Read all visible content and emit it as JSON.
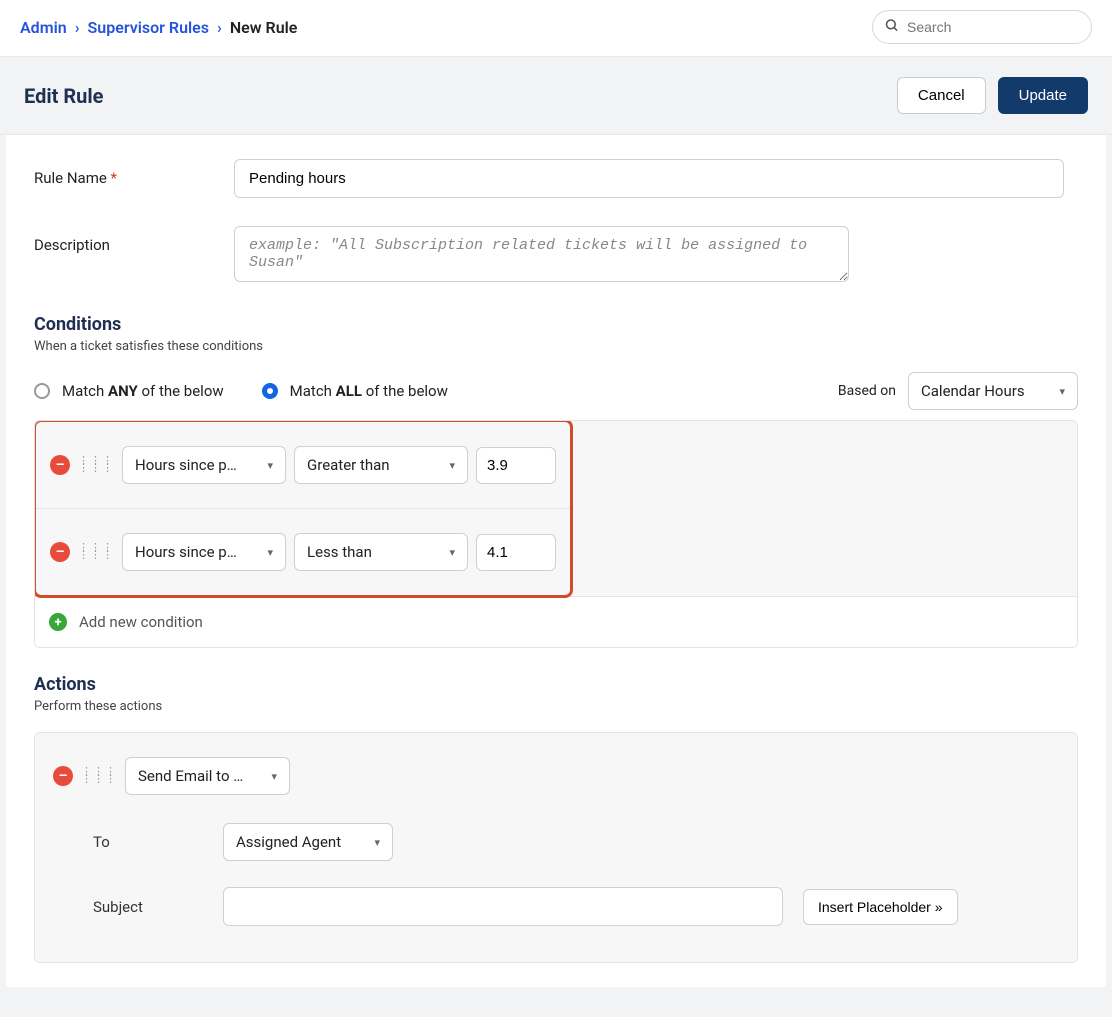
{
  "breadcrumb": {
    "admin": "Admin",
    "rules": "Supervisor Rules",
    "current": "New Rule"
  },
  "search": {
    "placeholder": "Search"
  },
  "header": {
    "title": "Edit Rule",
    "cancel": "Cancel",
    "update": "Update"
  },
  "form": {
    "ruleNameLabel": "Rule Name",
    "ruleNameValue": "Pending hours",
    "descLabel": "Description",
    "descPlaceholder": "example: \"All Subscription related tickets will be assigned to Susan\""
  },
  "conditions": {
    "title": "Conditions",
    "subtitle": "When a ticket satisfies these conditions",
    "matchAnyPrefix": "Match ",
    "matchAnyBold": "ANY",
    "matchAnySuffix": " of the below",
    "matchAllPrefix": "Match ",
    "matchAllBold": "ALL",
    "matchAllSuffix": " of the below",
    "basedOnLabel": "Based on",
    "basedOnValue": "Calendar Hours",
    "rows": [
      {
        "field": "Hours since p…",
        "op": "Greater than",
        "val": "3.9"
      },
      {
        "field": "Hours since p…",
        "op": "Less than",
        "val": "4.1"
      }
    ],
    "addNew": "Add new condition"
  },
  "actions": {
    "title": "Actions",
    "subtitle": "Perform these actions",
    "action1": "Send Email to …",
    "toLabel": "To",
    "toValue": "Assigned Agent",
    "subjectLabel": "Subject",
    "subjectValue": "",
    "placeholderBtn": "Insert Placeholder »"
  }
}
